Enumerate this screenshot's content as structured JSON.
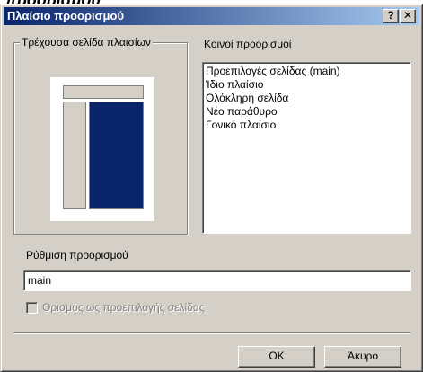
{
  "background_text": "προορισμού",
  "dialog": {
    "title": "Πλαίσιο προορισμού",
    "help_button": "?",
    "close_button": "✕"
  },
  "current_frames": {
    "label": "Τρέχουσα σελίδα πλαισίων"
  },
  "common_targets": {
    "label": "Κοινοί προορισμοί",
    "items": [
      "Προεπιλογές σελίδας (main)",
      "Ίδιο πλαίσιο",
      "Ολόκληρη σελίδα",
      "Νέο παράθυρο",
      "Γονικό πλαίσιο"
    ]
  },
  "target_setting": {
    "label": "Ρύθμιση προορισμού",
    "value": "main"
  },
  "default_checkbox": {
    "label": "Ορισμός ως προεπιλογής σελίδας",
    "checked": false,
    "enabled": false
  },
  "buttons": {
    "ok": "OK",
    "cancel": "Άκυρο"
  },
  "colors": {
    "titlebar_start": "#0a246a",
    "dialog_face": "#d4d0c8",
    "selected_frame": "#0a246a"
  }
}
